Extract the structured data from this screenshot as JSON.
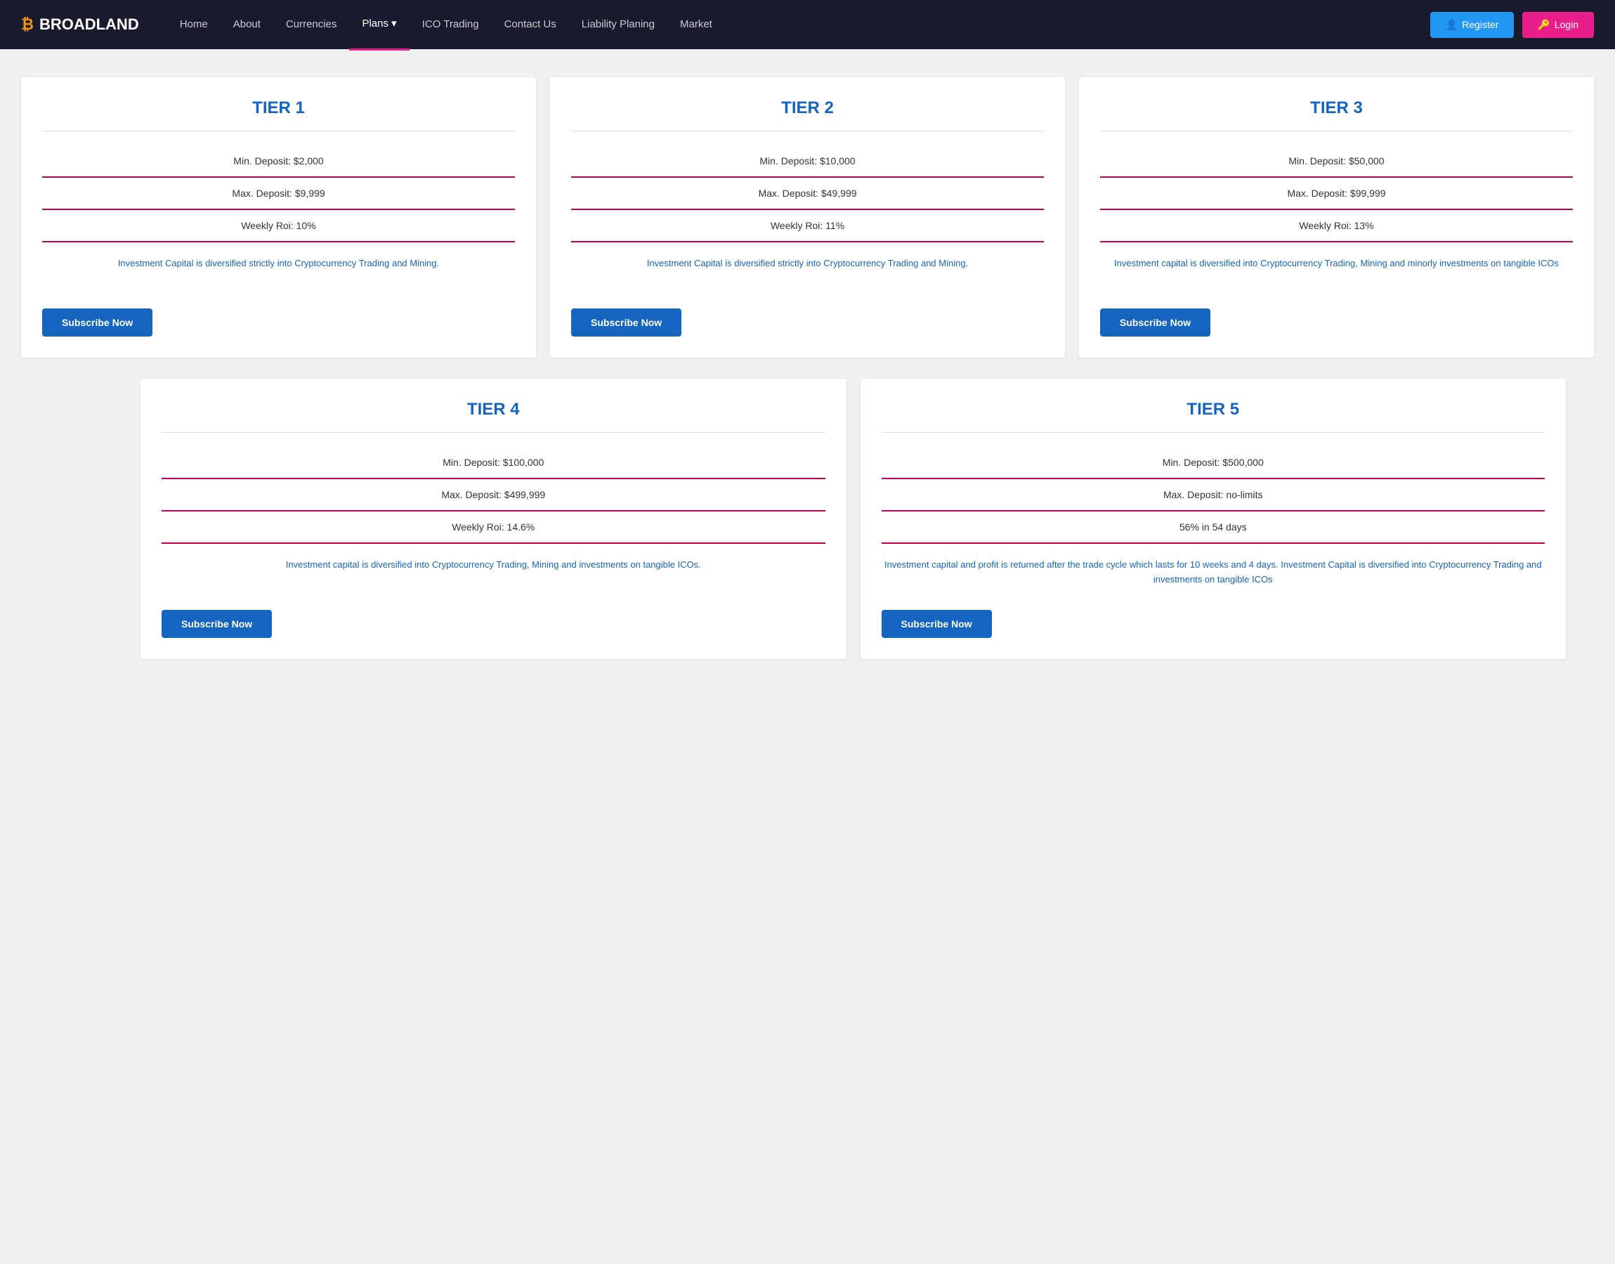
{
  "nav": {
    "logo": "BROADLAND",
    "btc_symbol": "₿",
    "links": [
      {
        "label": "Home",
        "active": false
      },
      {
        "label": "About",
        "active": false
      },
      {
        "label": "Currencies",
        "active": false
      },
      {
        "label": "Plans",
        "active": true,
        "has_dropdown": true
      },
      {
        "label": "ICO Trading",
        "active": false
      },
      {
        "label": "Contact Us",
        "active": false
      },
      {
        "label": "Liability Planing",
        "active": false
      },
      {
        "label": "Market",
        "active": false
      }
    ],
    "register_label": "Register",
    "login_label": "Login"
  },
  "tiers": [
    {
      "title": "TIER 1",
      "min_deposit": "Min. Deposit: $2,000",
      "max_deposit": "Max. Deposit: $9,999",
      "weekly_roi": "Weekly Roi: 10%",
      "description": "Investment Capital is diversified strictly into Cryptocurrency Trading and Mining.",
      "button": "Subscribe Now"
    },
    {
      "title": "TIER 2",
      "min_deposit": "Min. Deposit: $10,000",
      "max_deposit": "Max. Deposit: $49,999",
      "weekly_roi": "Weekly Roi: 11%",
      "description": "Investment Capital is diversified strictly into Cryptocurrency Trading and Mining.",
      "button": "Subscribe Now"
    },
    {
      "title": "TIER 3",
      "min_deposit": "Min. Deposit: $50,000",
      "max_deposit": "Max. Deposit: $99,999",
      "weekly_roi": "Weekly Roi: 13%",
      "description": "Investment capital is diversified into Cryptocurrency Trading, Mining and minorly investments on tangible ICOs",
      "button": "Subscribe Now"
    }
  ],
  "tiers_row2": [
    {
      "title": "TIER 4",
      "min_deposit": "Min. Deposit: $100,000",
      "max_deposit": "Max. Deposit: $499,999",
      "weekly_roi": "Weekly Roi: 14.6%",
      "description": "Investment capital is diversified into Cryptocurrency Trading, Mining and investments on tangible ICOs.",
      "button": "Subscribe Now"
    },
    {
      "title": "TIER 5",
      "min_deposit": "Min. Deposit: $500,000",
      "max_deposit": "Max. Deposit: no-limits",
      "weekly_roi": "56% in 54 days",
      "description": "Investment capital and profit is returned after the trade cycle which lasts for 10 weeks and 4 days. Investment Capital is diversified into Cryptocurrency Trading and investments on tangible ICOs",
      "button": "Subscribe Now"
    }
  ]
}
